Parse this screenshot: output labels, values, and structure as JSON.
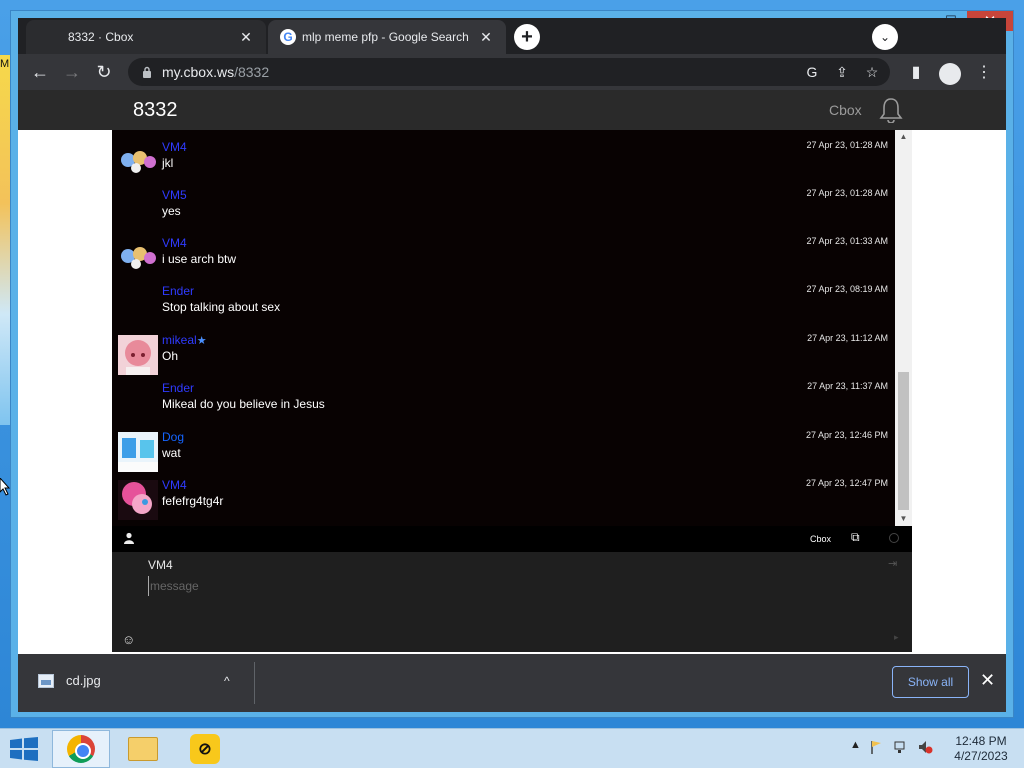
{
  "window": {
    "minimize": "▁",
    "maximize": "☐",
    "close": "✕"
  },
  "desktop": {
    "peek_text": "M"
  },
  "tabs": [
    {
      "title": "8332 · Cbox",
      "close": "✕"
    },
    {
      "title": "mlp meme pfp - Google Search",
      "close": "✕",
      "favicon": "G"
    }
  ],
  "new_tab_label": "+",
  "tab_search_label": "⌄",
  "toolbar": {
    "back": "←",
    "forward": "→",
    "reload": "↻",
    "url_host": "my.cbox.ws",
    "url_path": "/8332",
    "google_lens": "G",
    "share": "⇪",
    "bookmark": "☆",
    "side_panel": "▮",
    "menu": "⋮"
  },
  "cbox": {
    "title": "8332",
    "brand": "Cbox",
    "messages": [
      {
        "name": "VM4",
        "text": "jkl",
        "time": "27 Apr 23, 01:28 AM",
        "avatar": "ponies"
      },
      {
        "name": "VM5",
        "text": "yes",
        "time": "27 Apr 23, 01:28 AM",
        "avatar": "none"
      },
      {
        "name": "VM4",
        "text": "i use arch btw",
        "time": "27 Apr 23, 01:33 AM",
        "avatar": "ponies"
      },
      {
        "name": "Ender",
        "text": "Stop talking about sex",
        "time": "27 Apr 23, 08:19 AM",
        "avatar": "none"
      },
      {
        "name": "mikeal",
        "text": "Oh",
        "time": "27 Apr 23, 11:12 AM",
        "avatar": "pink-anime",
        "star": "★"
      },
      {
        "name": "Ender",
        "text": "Mikeal do you believe in Jesus",
        "time": "27 Apr 23, 11:37 AM",
        "avatar": "none"
      },
      {
        "name": "Dog",
        "text": "wat",
        "time": "27 Apr 23, 12:46 PM",
        "avatar": "blue-pony"
      },
      {
        "name": "VM4",
        "text": "fefefrg4tg4r",
        "time": "27 Apr 23, 12:47 PM",
        "avatar": "pinkie"
      }
    ],
    "scroll_up": "▲",
    "scroll_down": "▼",
    "footer_brand": "Cbox",
    "popout": "⧉",
    "composer_name": "VM4",
    "composer_placeholder": "message",
    "signin_icon": "⇥",
    "emoji_icon": "☺",
    "send_icon": "▸"
  },
  "downloads": {
    "file": "cd.jpg",
    "chevron": "^",
    "show_all": "Show all",
    "close": "✕"
  },
  "taskbar": {
    "ld_label": "⊘",
    "tray_arrow": "▲",
    "time": "12:48 PM",
    "date": "4/27/2023"
  }
}
